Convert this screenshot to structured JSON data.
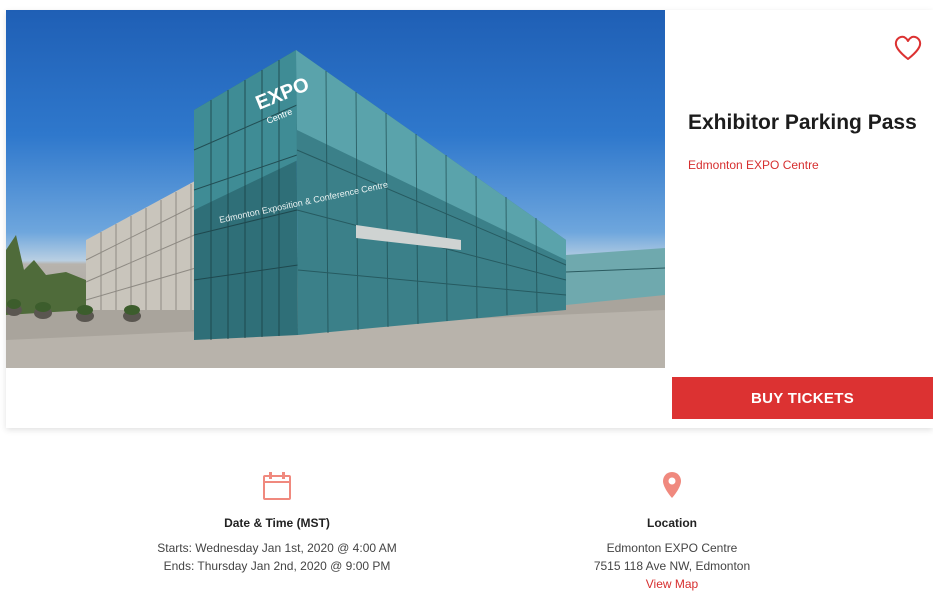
{
  "event": {
    "title": "Exhibitor Parking Pass",
    "venue": "Edmonton EXPO Centre",
    "building_signage": {
      "expo": "EXPO",
      "centre": "Centre",
      "exhibition": "Edmonton Exposition & Conference Centre"
    }
  },
  "actions": {
    "buy_label": "BUY TICKETS",
    "favorite_icon": "heart-outline-icon"
  },
  "date_time": {
    "icon": "calendar-icon",
    "heading": "Date & Time (MST)",
    "starts": "Starts: Wednesday Jan 1st, 2020 @ 4:00 AM",
    "ends": "Ends: Thursday Jan 2nd, 2020 @ 9:00 PM"
  },
  "location": {
    "icon": "map-pin-icon",
    "heading": "Location",
    "name": "Edmonton EXPO Centre",
    "address": "7515 118 Ave NW, Edmonton",
    "map_link": "View Map"
  },
  "colors": {
    "accent": "#dc3232",
    "icon_tint": "#f0897e"
  }
}
